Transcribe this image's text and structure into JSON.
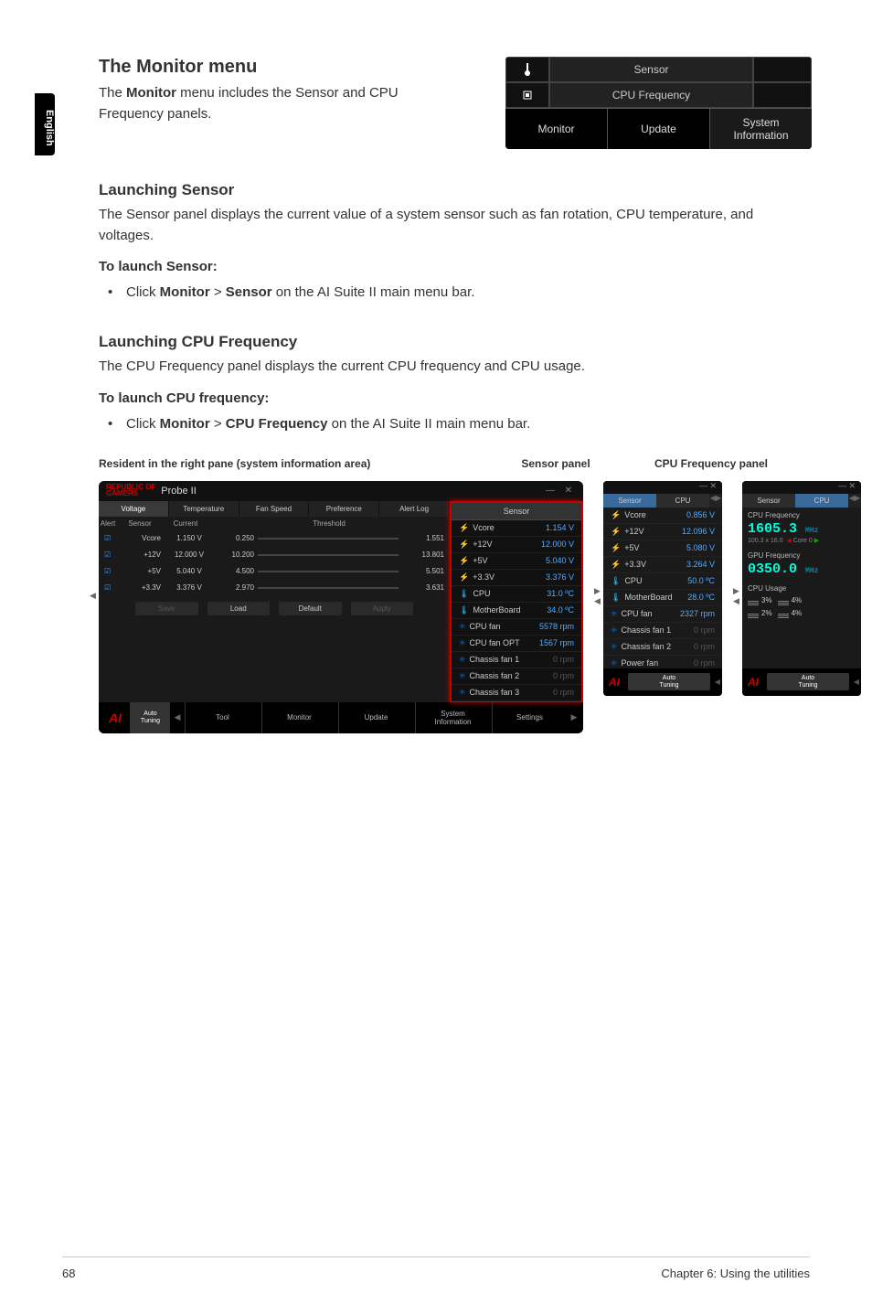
{
  "sidebar_language": "English",
  "h_monitor_menu": "The Monitor menu",
  "p_monitor_intro_a": "The ",
  "p_monitor_intro_b": "Monitor",
  "p_monitor_intro_c": " menu includes the Sensor and CPU Frequency panels.",
  "mini": {
    "row1_label": "Sensor",
    "row2_label": "CPU Frequency",
    "btn1": "Monitor",
    "btn2": "Update",
    "btn3": "System\nInformation"
  },
  "h_launch_sensor": "Launching Sensor",
  "p_launch_sensor": "The Sensor panel displays the current value of a system sensor such as fan rotation, CPU temperature, and voltages.",
  "t_launch_sensor": "To launch Sensor:",
  "li_sensor_a": "Click ",
  "li_sensor_b": "Monitor",
  "li_sensor_c": " > ",
  "li_sensor_d": "Sensor",
  "li_sensor_e": " on the AI Suite II main menu bar.",
  "h_launch_cpu": "Launching CPU Frequency",
  "p_launch_cpu": "The CPU Frequency panel displays the current CPU frequency and CPU usage.",
  "t_launch_cpu": "To launch CPU frequency:",
  "li_cpu_a": "Click ",
  "li_cpu_b": "Monitor",
  "li_cpu_c": " > ",
  "li_cpu_d": "CPU Frequency",
  "li_cpu_e": " on the AI Suite II main menu bar.",
  "label_resident": "Resident in the right pane (system information area)",
  "label_sensor_panel": "Sensor panel",
  "label_cpu_panel": "CPU Frequency panel",
  "probe": {
    "brand_line1": "REPUBLIC OF",
    "brand_line2": "GAMERS",
    "title": "Probe II",
    "tabs": [
      "Voltage",
      "Temperature",
      "Fan Speed",
      "Preference",
      "Alert Log"
    ],
    "head": {
      "alert": "Alert",
      "sensor": "Sensor",
      "current": "Current",
      "threshold": "Threshold"
    },
    "rows": [
      {
        "name": "Vcore",
        "current": "1.150 V",
        "lo": "0.250",
        "hi": "1.551"
      },
      {
        "name": "+12V",
        "current": "12.000 V",
        "lo": "10.200",
        "hi": "13.801"
      },
      {
        "name": "+5V",
        "current": "5.040 V",
        "lo": "4.500",
        "hi": "5.501"
      },
      {
        "name": "+3.3V",
        "current": "3.376 V",
        "lo": "2.970",
        "hi": "3.631"
      }
    ],
    "footer_btns": [
      "Save",
      "Load",
      "Default",
      "Apply"
    ],
    "bottom": [
      "Auto\nTuning",
      "Tool",
      "Monitor",
      "Update",
      "System\nInformation",
      "Settings"
    ],
    "right_title": "Sensor",
    "right_items": [
      {
        "ico": "bolt",
        "name": "Vcore",
        "val": "1.154 V"
      },
      {
        "ico": "bolt",
        "name": "+12V",
        "val": "12.000 V"
      },
      {
        "ico": "bolt",
        "name": "+5V",
        "val": "5.040 V"
      },
      {
        "ico": "bolt",
        "name": "+3.3V",
        "val": "3.376 V"
      },
      {
        "ico": "temp",
        "name": "CPU",
        "val": "31.0 ºC"
      },
      {
        "ico": "temp",
        "name": "MotherBoard",
        "val": "34.0 ºC"
      },
      {
        "ico": "fan",
        "name": "CPU fan",
        "val": "5578 rpm"
      },
      {
        "ico": "fan",
        "name": "CPU fan OPT",
        "val": "1567 rpm"
      },
      {
        "ico": "fan",
        "name": "Chassis fan 1",
        "val": "0 rpm",
        "dim": true
      },
      {
        "ico": "fan",
        "name": "Chassis fan 2",
        "val": "0 rpm",
        "dim": true
      },
      {
        "ico": "fan",
        "name": "Chassis fan 3",
        "val": "0 rpm",
        "dim": true
      }
    ]
  },
  "sensor_panel": {
    "tabs": [
      "Sensor",
      "CPU"
    ],
    "items": [
      {
        "ico": "bolt",
        "name": "Vcore",
        "val": "0.856 V"
      },
      {
        "ico": "bolt",
        "name": "+12V",
        "val": "12.096 V"
      },
      {
        "ico": "bolt",
        "name": "+5V",
        "val": "5.080 V"
      },
      {
        "ico": "bolt",
        "name": "+3.3V",
        "val": "3.264 V"
      },
      {
        "ico": "temp",
        "name": "CPU",
        "val": "50.0 ºC"
      },
      {
        "ico": "temp",
        "name": "MotherBoard",
        "val": "28.0 ºC"
      },
      {
        "ico": "fan",
        "name": "CPU fan",
        "val": "2327 rpm"
      },
      {
        "ico": "fan",
        "name": "Chassis fan 1",
        "val": "0 rpm",
        "dim": true
      },
      {
        "ico": "fan",
        "name": "Chassis fan 2",
        "val": "0 rpm",
        "dim": true
      },
      {
        "ico": "fan",
        "name": "Power fan",
        "val": "0 rpm",
        "dim": true
      }
    ],
    "auto": "Auto\nTuning"
  },
  "cpu_panel": {
    "tabs": [
      "Sensor",
      "CPU"
    ],
    "sec1_title": "CPU Frequency",
    "sec1_value": "1605.3",
    "sec1_unit": "MHz",
    "sec1_sub": "100.3 x 16.0",
    "sec1_core": "Core 0",
    "sec2_title": "GPU Frequency",
    "sec2_value": "0350.0",
    "sec2_unit": "MHz",
    "sec3_title": "CPU Usage",
    "usage": [
      {
        "pct": "3%",
        "pct2": "4%"
      },
      {
        "pct": "2%",
        "pct2": "4%"
      }
    ],
    "auto": "Auto\nTuning"
  },
  "footer_left": "68",
  "footer_right": "Chapter 6: Using the utilities"
}
